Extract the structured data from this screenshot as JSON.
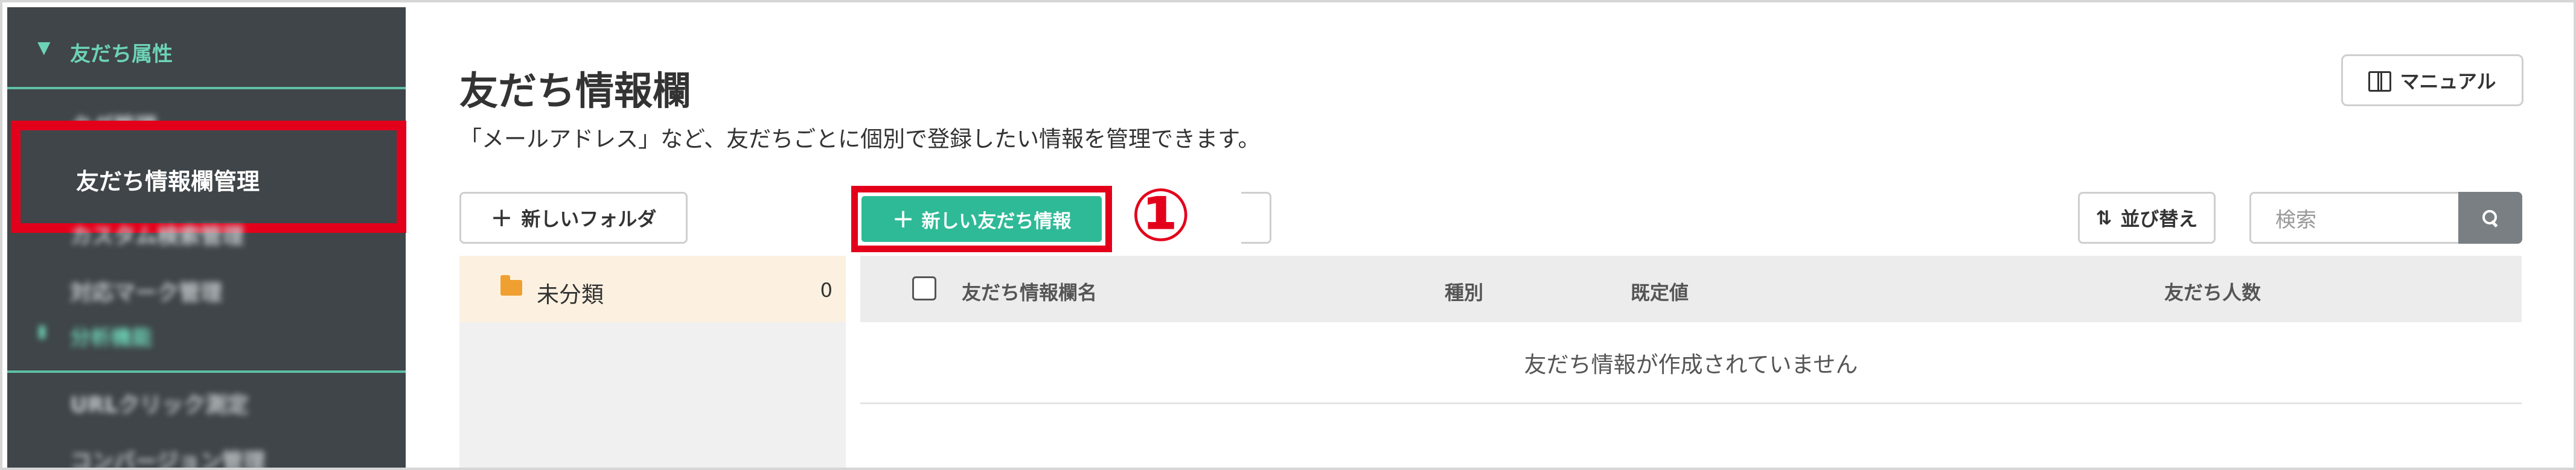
{
  "sidebar": {
    "section_friend_attributes": "友だち属性",
    "item_tag_management": "タグ管理",
    "item_friend_info_management": "友だち情報欄管理",
    "item_custom_search_management": "カスタム検索管理",
    "item_response_mark_management": "対応マーク管理",
    "section_analysis": "分析機能",
    "item_url_click_measurement": "URLクリック測定",
    "item_conversion_management": "コンバージョン管理"
  },
  "header": {
    "title": "友だち情報欄",
    "description": "「メールアドレス」など、友だちごとに個別で登録したい情報を管理できます。",
    "manual_label": "マニュアル"
  },
  "toolbar": {
    "new_folder_label": "新しいフォルダ",
    "new_friend_info_label": "新しい友だち情報",
    "more_label": "⋮",
    "sort_label": "並び替え",
    "search_placeholder": "検索"
  },
  "annotation": {
    "step_marker": "①",
    "highlight_color": "#e3001b"
  },
  "folders": [
    {
      "name": "未分類",
      "count": "0"
    }
  ],
  "table": {
    "columns": [
      "友だち情報欄名",
      "種別",
      "既定値",
      "友だち人数"
    ],
    "empty_message": "友だち情報が作成されていません"
  },
  "colors": {
    "accent": "#2fba97",
    "sidebar_bg": "#3f4549",
    "sidebar_accent": "#6dd3b6",
    "folder_selected_bg": "#fcf1e0"
  }
}
